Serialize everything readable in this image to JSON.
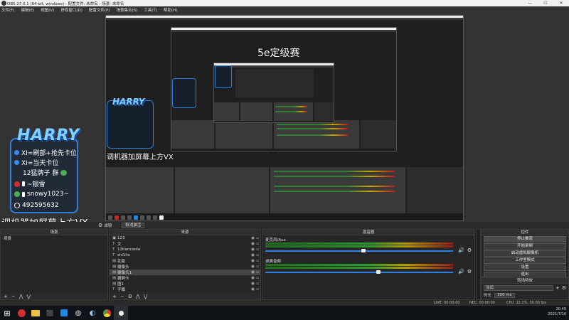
{
  "window": {
    "title": "OBS 27.0.1 (64-bit, windows) - 配置文件: 未命名 - 场景: 未命名",
    "controls": {
      "minimize": "—",
      "maximize": "☐",
      "close": "✕"
    }
  },
  "menu": [
    "文件(F)",
    "编辑(E)",
    "视图(V)",
    "停靠窗口(D)",
    "配置文件(P)",
    "场景集合(S)",
    "工具(T)",
    "帮助(H)"
  ],
  "preview": {
    "title_5e": "5e定级赛",
    "caption_top": "调机器加屏幕上方VX",
    "caption_large": "调机器加屏幕上方VX",
    "overlay": {
      "logo": "HARRY",
      "lines": [
        "XI=刷部+抢先卡位",
        "XI=当天卡位",
        "12猛牌子 群",
        "~银雪",
        "snowy1023~",
        "492595632"
      ]
    }
  },
  "controls_bar": {
    "filter_label": "滤镜",
    "deselect_label": "取消激活"
  },
  "scenes": {
    "header": "场景",
    "items": [
      "场景"
    ]
  },
  "sources": {
    "header": "来源",
    "items": [
      {
        "type": "icon",
        "name": "123"
      },
      {
        "type": "T",
        "name": "文"
      },
      {
        "type": "T",
        "name": "12tiancaola"
      },
      {
        "type": "T",
        "name": "shi1hs"
      },
      {
        "type": "img",
        "name": "花瓶"
      },
      {
        "type": "img",
        "name": "摄像头"
      },
      {
        "type": "img",
        "name": "摄像头1"
      },
      {
        "type": "img",
        "name": "霸屏卡"
      },
      {
        "type": "img",
        "name": "图1"
      },
      {
        "type": "T",
        "name": "字幕"
      }
    ]
  },
  "mixer": {
    "header": "混音器",
    "channels": [
      {
        "name": "麦克风/Aux",
        "level": 0.52
      },
      {
        "name": "桌面音频",
        "level": 0.6
      }
    ]
  },
  "scene_transitions": {
    "header": "转场特效",
    "type": "淡出",
    "duration_label": "时长",
    "duration_value": "300 ms"
  },
  "controls": {
    "header": "控件",
    "buttons": [
      "停止推流",
      "开始录制",
      "启动虚拟摄像机",
      "工作室模式",
      "设置",
      "退出"
    ]
  },
  "status": {
    "live": "LIVE: 00:00:00",
    "rec": "REC: 00:00:00",
    "cpu": "CPU: 12.1%, 30.00 fps"
  },
  "taskbar": {
    "icons": [
      "windows-start-icon",
      "netease-icon",
      "folder-icon",
      "game-icon",
      "app-icon",
      "steam-icon",
      "steam-alt-icon",
      "chrome-icon",
      "obs-icon"
    ],
    "time": "20:49",
    "date": "2021/7/16"
  },
  "colors": {
    "accent": "#2f7fe0",
    "meter_green": "#2e9a2e",
    "meter_yellow": "#b79b00",
    "meter_red": "#8b1c1c"
  }
}
